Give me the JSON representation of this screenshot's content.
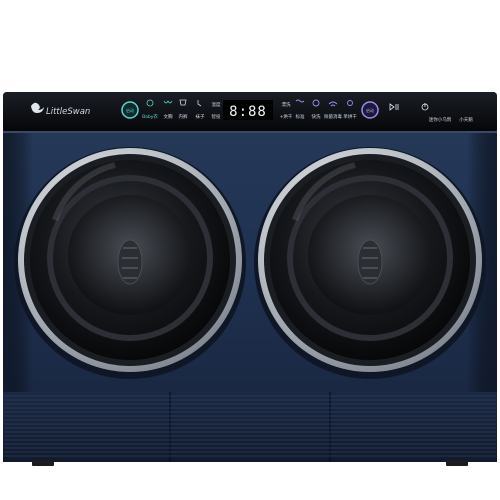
{
  "brand": {
    "name": "LittleSwan",
    "logo_icon": "swan-icon"
  },
  "control_panel": {
    "left_button_label": "启动",
    "programs": [
      {
        "label": "Baby衣",
        "icon": "baby-icon"
      },
      {
        "label": "文胸",
        "icon": "bra-icon"
      },
      {
        "label": "内裤",
        "icon": "underwear-icon"
      },
      {
        "label": "袜子",
        "icon": "sock-icon"
      }
    ],
    "left_options": [
      "温度",
      "智投"
    ],
    "display_value": "8:88",
    "right_options_top": [
      "漂洗",
      "+烘干"
    ],
    "right_modes": [
      {
        "label": "标准",
        "icon": "wave-icon"
      },
      {
        "label": "快洗",
        "icon": "fast-wash-icon"
      },
      {
        "label": "除菌消毒",
        "icon": "wifi-icon"
      },
      {
        "label": "单烘干",
        "icon": "sun-icon"
      }
    ],
    "right_button_label": "启动",
    "play_pause_icon": "play-pause-icon",
    "power_icon": "power-icon",
    "right_text": [
      "迷你小乌鸦",
      "小天鹅"
    ]
  },
  "colors": {
    "body": "#243553",
    "panel": "#0d1015",
    "accent_cyan": "#58d6d2",
    "accent_purple": "#9a8df0",
    "ring": "#cfd3d8"
  }
}
